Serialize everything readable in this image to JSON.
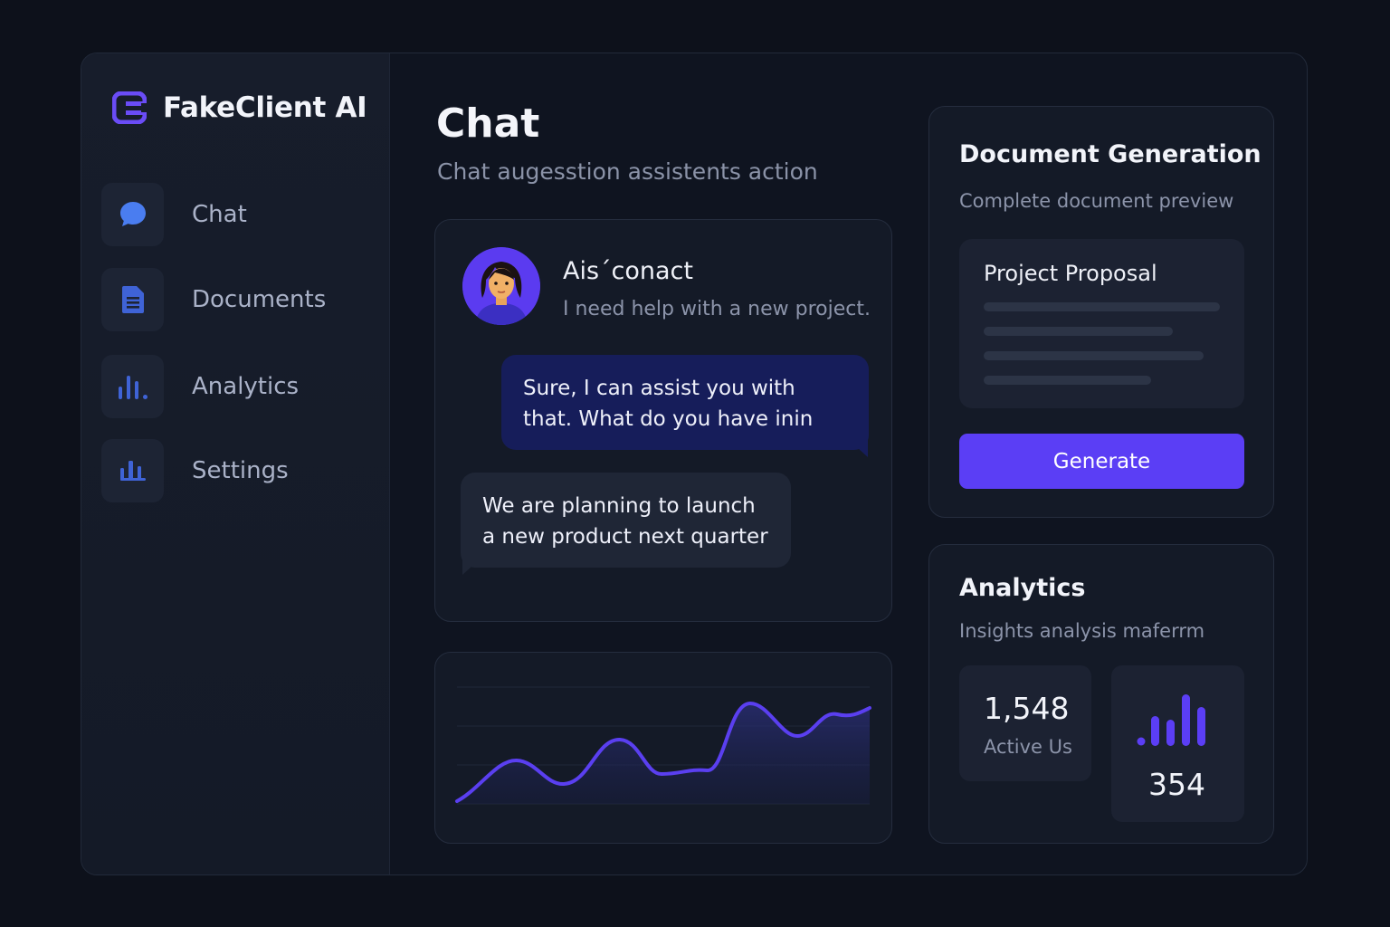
{
  "app": {
    "name": "FakeClient AI"
  },
  "sidebar": {
    "items": [
      {
        "label": "Chat",
        "icon": "chat-bubble-icon"
      },
      {
        "label": "Documents",
        "icon": "document-icon"
      },
      {
        "label": "Analytics",
        "icon": "bar-chart-icon"
      },
      {
        "label": "Settings",
        "icon": "settings-bars-icon"
      }
    ]
  },
  "main": {
    "title": "Chat",
    "subtitle": "Chat augesstion assistents action"
  },
  "chat": {
    "contact_name": "Ais´conact",
    "contact_message": "I need help with a new project.",
    "reply_out": "Sure, I can assist you with that. What do you have inin",
    "reply_in": "We are planning to launch a new product next quarter"
  },
  "document_generation": {
    "title": "Document Generation",
    "subtitle": "Complete document preview",
    "preview_title": "Project Proposal",
    "button_label": "Generate"
  },
  "analytics": {
    "title": "Analytics",
    "subtitle": "Insights analysis maferrm",
    "active_users_value": "1,548",
    "active_users_label": "Active Us",
    "bars_value": "354"
  },
  "colors": {
    "accent": "#5b3ef5",
    "line": "#5a3ff0",
    "nav_icon": "#3f63d6",
    "background": "#0d111b"
  }
}
